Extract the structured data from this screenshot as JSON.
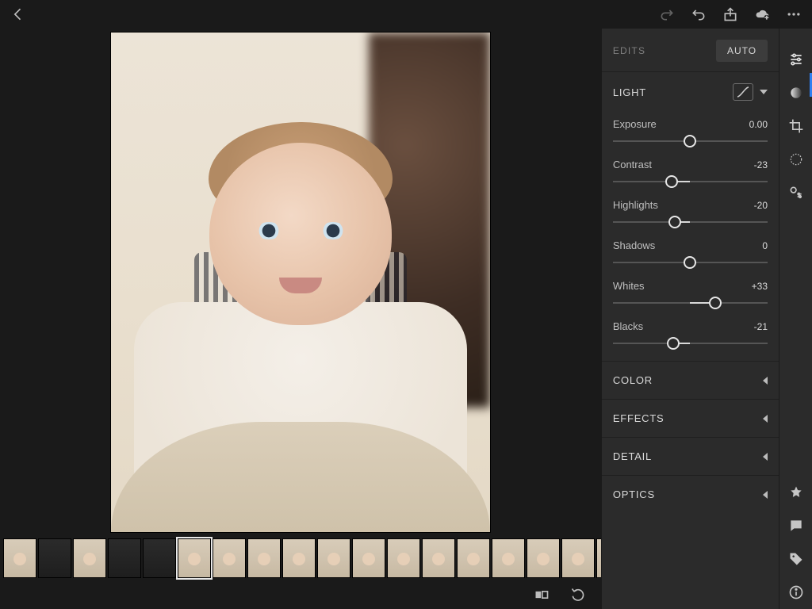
{
  "topbar": {
    "icons": {
      "back": "back-icon",
      "redo": "redo-icon",
      "undo": "undo-icon",
      "share": "share-icon",
      "cloud": "cloud-sync-icon",
      "more": "more-icon"
    }
  },
  "panel": {
    "edits_label": "EDITS",
    "auto_label": "AUTO",
    "light": {
      "title": "LIGHT",
      "sliders": [
        {
          "name": "Exposure",
          "value": "0.00",
          "pos": 50,
          "center": 50
        },
        {
          "name": "Contrast",
          "value": "-23",
          "pos": 38,
          "center": 50
        },
        {
          "name": "Highlights",
          "value": "-20",
          "pos": 40,
          "center": 50
        },
        {
          "name": "Shadows",
          "value": "0",
          "pos": 50,
          "center": 50
        },
        {
          "name": "Whites",
          "value": "+33",
          "pos": 66,
          "center": 50
        },
        {
          "name": "Blacks",
          "value": "-21",
          "pos": 39,
          "center": 50
        }
      ]
    },
    "collapsed": [
      {
        "title": "COLOR"
      },
      {
        "title": "EFFECTS"
      },
      {
        "title": "DETAIL"
      },
      {
        "title": "OPTICS"
      }
    ]
  },
  "rail": {
    "top": [
      "adjust-sliders-icon",
      "gradient-circle-icon",
      "crop-icon",
      "healing-brush-icon",
      "local-adjust-icon"
    ],
    "bottom": [
      "star-icon",
      "comment-icon",
      "tag-icon",
      "info-icon"
    ],
    "selected_index": 0
  },
  "filmstrip": {
    "count": 18,
    "dark_slots": [
      1,
      3,
      4
    ],
    "selected_index": 5
  },
  "bottom_tools": {
    "icons": [
      "before-after-icon",
      "reset-icon"
    ]
  }
}
